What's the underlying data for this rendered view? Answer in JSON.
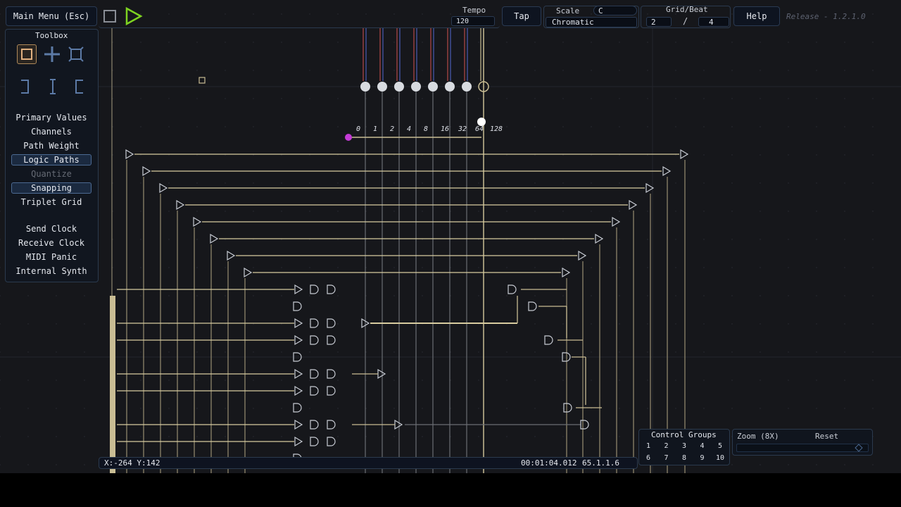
{
  "topbar": {
    "main_menu": "Main Menu (Esc)",
    "tempo_label": "Tempo",
    "tempo_value": "120",
    "tap_label": "Tap",
    "scale_label": "Scale",
    "scale_key": "C",
    "scale_mode": "Chromatic",
    "gridbeat_label": "Grid/Beat",
    "grid_value": "2",
    "separator": "/",
    "beat_value": "4",
    "help_label": "Help",
    "release": "Release - 1.2.1.0"
  },
  "toolbox": {
    "title": "Toolbox",
    "tools": [
      "square-select-icon",
      "crosshair-icon",
      "rotate-select-icon"
    ],
    "edit_tools": [
      "undo-icon",
      "cursor-icon",
      "redo-icon"
    ],
    "view_items": [
      {
        "label": "Primary Values",
        "active": false,
        "dim": false
      },
      {
        "label": "Channels",
        "active": false,
        "dim": false
      },
      {
        "label": "Path Weight",
        "active": false,
        "dim": false
      },
      {
        "label": "Logic Paths",
        "active": true,
        "dim": false
      },
      {
        "label": "Quantize",
        "active": false,
        "dim": true
      },
      {
        "label": "Snapping",
        "active": true,
        "dim": false
      },
      {
        "label": "Triplet Grid",
        "active": false,
        "dim": false
      }
    ],
    "clock_items": [
      "Send Clock",
      "Receive Clock",
      "MIDI Panic",
      "Internal Synth"
    ]
  },
  "binary_labels": [
    "0",
    "1",
    "2",
    "4",
    "8",
    "16",
    "32",
    "64",
    "128"
  ],
  "status": {
    "coords": "X:-264 Y:142",
    "time": "00:01:04.012",
    "position": "65.1.1.6"
  },
  "control_groups": {
    "title": "Control Groups",
    "numbers": [
      "1",
      "2",
      "3",
      "4",
      "5",
      "6",
      "7",
      "8",
      "9",
      "10"
    ]
  },
  "zoom": {
    "label": "Zoom (8X)",
    "reset": "Reset",
    "level": 0.95
  }
}
